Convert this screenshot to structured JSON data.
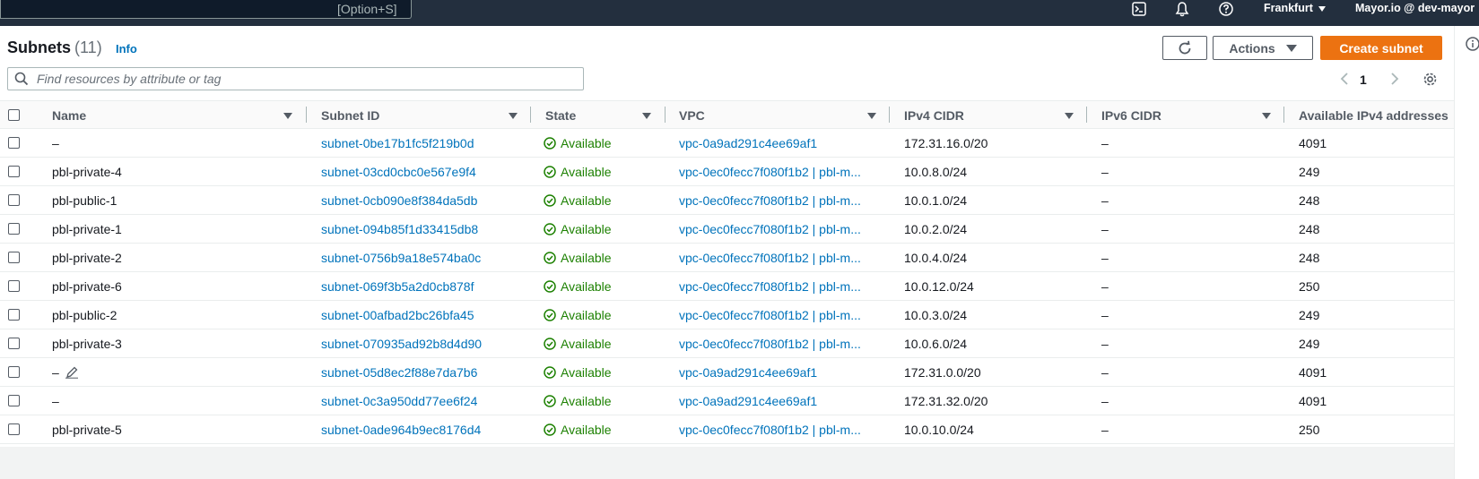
{
  "topbar": {
    "search_shortcut": "[Option+S]",
    "region": "Frankfurt",
    "account": "Mayor.io @ dev-mayor"
  },
  "header": {
    "title": "Subnets",
    "count": "(11)",
    "info": "Info",
    "actions_label": "Actions",
    "create_label": "Create subnet"
  },
  "search": {
    "placeholder": "Find resources by attribute or tag",
    "value": ""
  },
  "pagination": {
    "current_page": "1"
  },
  "columns": [
    "Name",
    "Subnet ID",
    "State",
    "VPC",
    "IPv4 CIDR",
    "IPv6 CIDR",
    "Available IPv4 addresses"
  ],
  "rows": [
    {
      "name": "–",
      "subnet_id": "subnet-0be17b1fc5f219b0d",
      "state": "Available",
      "vpc": "vpc-0a9ad291c4ee69af1",
      "ipv4": "172.31.16.0/20",
      "ipv6": "–",
      "available": "4091"
    },
    {
      "name": "pbl-private-4",
      "subnet_id": "subnet-03cd0cbc0e567e9f4",
      "state": "Available",
      "vpc": "vpc-0ec0fecc7f080f1b2 | pbl-m...",
      "ipv4": "10.0.8.0/24",
      "ipv6": "–",
      "available": "249"
    },
    {
      "name": "pbl-public-1",
      "subnet_id": "subnet-0cb090e8f384da5db",
      "state": "Available",
      "vpc": "vpc-0ec0fecc7f080f1b2 | pbl-m...",
      "ipv4": "10.0.1.0/24",
      "ipv6": "–",
      "available": "248"
    },
    {
      "name": "pbl-private-1",
      "subnet_id": "subnet-094b85f1d33415db8",
      "state": "Available",
      "vpc": "vpc-0ec0fecc7f080f1b2 | pbl-m...",
      "ipv4": "10.0.2.0/24",
      "ipv6": "–",
      "available": "248"
    },
    {
      "name": "pbl-private-2",
      "subnet_id": "subnet-0756b9a18e574ba0c",
      "state": "Available",
      "vpc": "vpc-0ec0fecc7f080f1b2 | pbl-m...",
      "ipv4": "10.0.4.0/24",
      "ipv6": "–",
      "available": "248"
    },
    {
      "name": "pbl-private-6",
      "subnet_id": "subnet-069f3b5a2d0cb878f",
      "state": "Available",
      "vpc": "vpc-0ec0fecc7f080f1b2 | pbl-m...",
      "ipv4": "10.0.12.0/24",
      "ipv6": "–",
      "available": "250"
    },
    {
      "name": "pbl-public-2",
      "subnet_id": "subnet-00afbad2bc26bfa45",
      "state": "Available",
      "vpc": "vpc-0ec0fecc7f080f1b2 | pbl-m...",
      "ipv4": "10.0.3.0/24",
      "ipv6": "–",
      "available": "249"
    },
    {
      "name": "pbl-private-3",
      "subnet_id": "subnet-070935ad92b8d4d90",
      "state": "Available",
      "vpc": "vpc-0ec0fecc7f080f1b2 | pbl-m...",
      "ipv4": "10.0.6.0/24",
      "ipv6": "–",
      "available": "249"
    },
    {
      "name": "–",
      "subnet_id": "subnet-05d8ec2f88e7da7b6",
      "state": "Available",
      "vpc": "vpc-0a9ad291c4ee69af1",
      "ipv4": "172.31.0.0/20",
      "ipv6": "–",
      "available": "4091",
      "edit_icon": "pencil-icon"
    },
    {
      "name": "–",
      "subnet_id": "subnet-0c3a950dd77ee6f24",
      "state": "Available",
      "vpc": "vpc-0a9ad291c4ee69af1",
      "ipv4": "172.31.32.0/20",
      "ipv6": "–",
      "available": "4091"
    },
    {
      "name": "pbl-private-5",
      "subnet_id": "subnet-0ade964b9ec8176d4",
      "state": "Available",
      "vpc": "vpc-0ec0fecc7f080f1b2 | pbl-m...",
      "ipv4": "10.0.10.0/24",
      "ipv6": "–",
      "available": "250"
    }
  ],
  "colors": {
    "topbar": "#232f3e",
    "link": "#0073bb",
    "available": "#1d8102",
    "primary": "#ec7211"
  },
  "icons": [
    "terminal-icon",
    "bell-icon",
    "help-icon",
    "refresh-icon",
    "search-icon",
    "chevron-left-icon",
    "chevron-right-icon",
    "settings-icon",
    "check-circle-icon",
    "pencil-icon"
  ]
}
